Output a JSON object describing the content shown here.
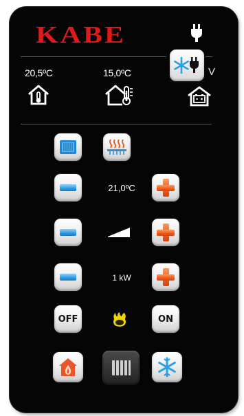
{
  "header": {
    "logo_text": "KABE",
    "voltage_label": "V",
    "icons": [
      "plug-icon",
      "snowflake-plug-icon"
    ]
  },
  "temperatures": {
    "indoor": "20,5ºC",
    "outdoor": "15,0ºC"
  },
  "controls": {
    "set_temperature": "21,0ºC",
    "power_label": "1 kW",
    "off_label": "OFF",
    "on_label": "ON"
  },
  "colors": {
    "brand_red": "#e01a1a",
    "minus_blue": "#2f9be0",
    "plus_orange": "#ef5a1c",
    "flame_yellow": "#f0d400",
    "panel_black": "#050505"
  }
}
